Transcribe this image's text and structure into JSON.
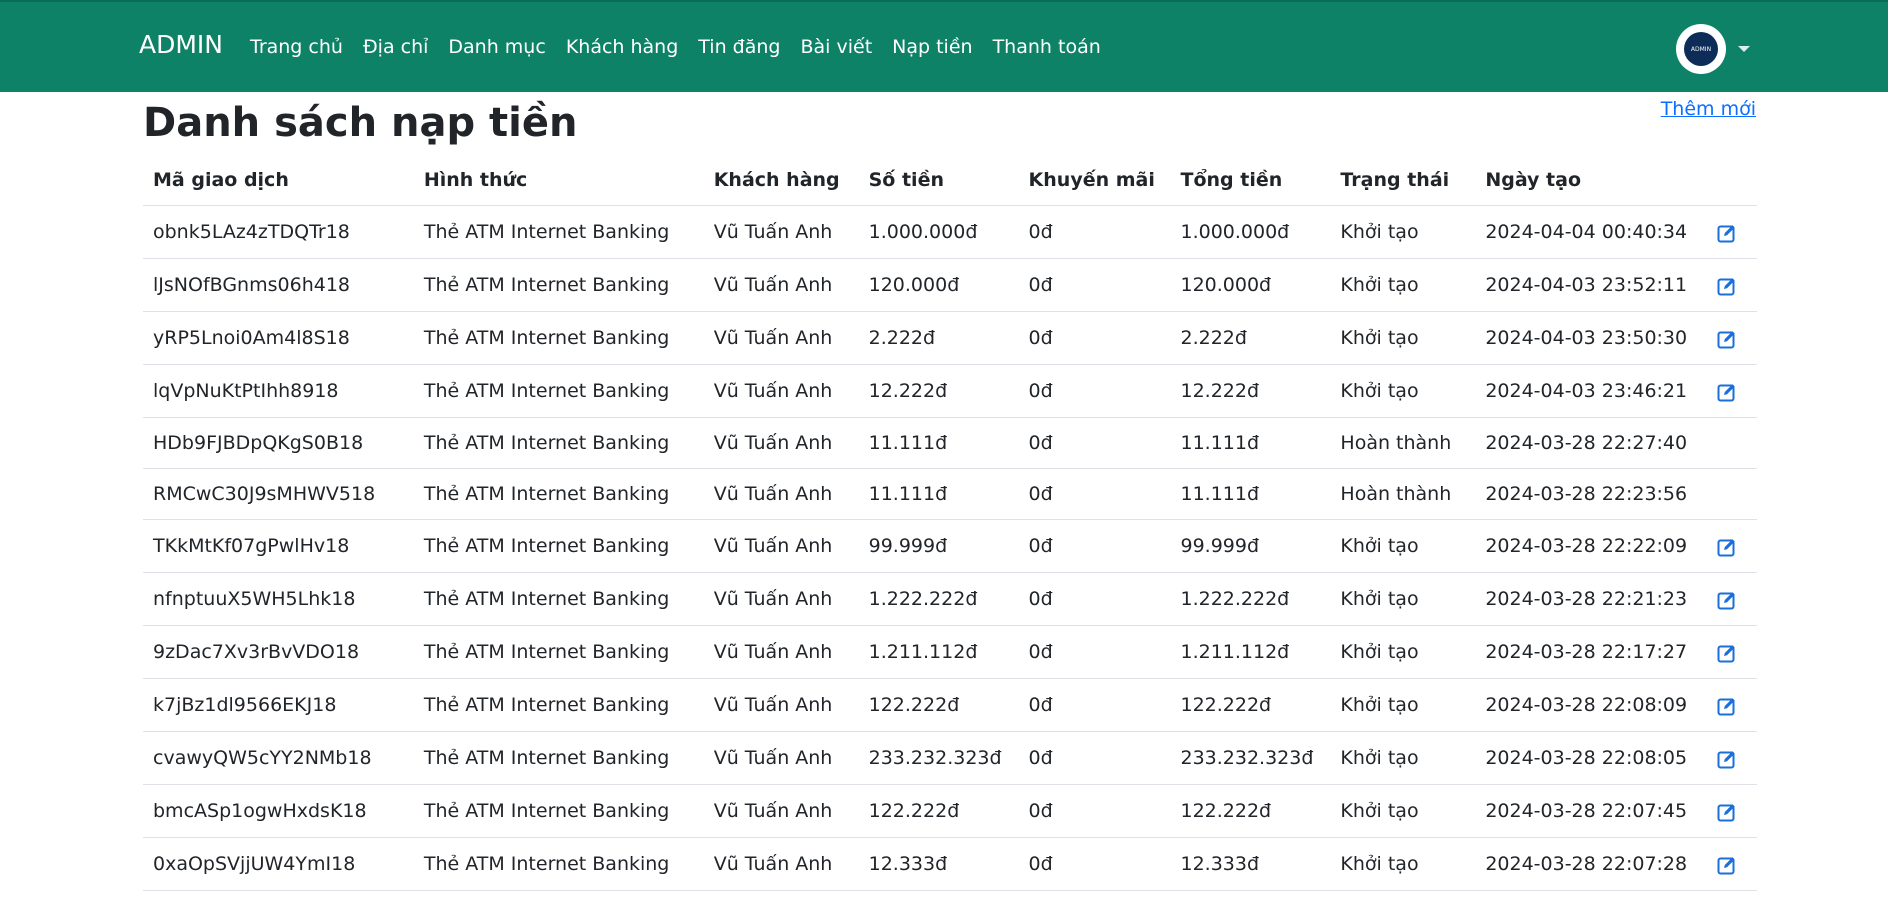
{
  "nav": {
    "brand": "ADMIN",
    "links": [
      "Trang chủ",
      "Địa chỉ",
      "Danh mục",
      "Khách hàng",
      "Tin đăng",
      "Bài viết",
      "Nạp tiền",
      "Thanh toán"
    ],
    "avatar_text": "ADMIN"
  },
  "page": {
    "title": "Danh sách nạp tiền",
    "add_label": "Thêm mới"
  },
  "table": {
    "headers": [
      "Mã giao dịch",
      "Hình thức",
      "Khách hàng",
      "Số tiền",
      "Khuyến mãi",
      "Tổng tiền",
      "Trạng thái",
      "Ngày tạo"
    ],
    "rows": [
      {
        "code": "obnk5LAz4zTDQTr18",
        "method": "Thẻ ATM Internet Banking",
        "customer": "Vũ Tuấn Anh",
        "amount": "1.000.000đ",
        "promo": "0đ",
        "total": "1.000.000đ",
        "status": "Khởi tạo",
        "date": "2024-04-04 00:40:34",
        "editable": true
      },
      {
        "code": "lJsNOfBGnms06h418",
        "method": "Thẻ ATM Internet Banking",
        "customer": "Vũ Tuấn Anh",
        "amount": "120.000đ",
        "promo": "0đ",
        "total": "120.000đ",
        "status": "Khởi tạo",
        "date": "2024-04-03 23:52:11",
        "editable": true
      },
      {
        "code": "yRP5Lnoi0Am4l8S18",
        "method": "Thẻ ATM Internet Banking",
        "customer": "Vũ Tuấn Anh",
        "amount": "2.222đ",
        "promo": "0đ",
        "total": "2.222đ",
        "status": "Khởi tạo",
        "date": "2024-04-03 23:50:30",
        "editable": true
      },
      {
        "code": "lqVpNuKtPtIhh8918",
        "method": "Thẻ ATM Internet Banking",
        "customer": "Vũ Tuấn Anh",
        "amount": "12.222đ",
        "promo": "0đ",
        "total": "12.222đ",
        "status": "Khởi tạo",
        "date": "2024-04-03 23:46:21",
        "editable": true
      },
      {
        "code": "HDb9FJBDpQKgS0B18",
        "method": "Thẻ ATM Internet Banking",
        "customer": "Vũ Tuấn Anh",
        "amount": "11.111đ",
        "promo": "0đ",
        "total": "11.111đ",
        "status": "Hoàn thành",
        "date": "2024-03-28 22:27:40",
        "editable": false
      },
      {
        "code": "RMCwC30J9sMHWV518",
        "method": "Thẻ ATM Internet Banking",
        "customer": "Vũ Tuấn Anh",
        "amount": "11.111đ",
        "promo": "0đ",
        "total": "11.111đ",
        "status": "Hoàn thành",
        "date": "2024-03-28 22:23:56",
        "editable": false
      },
      {
        "code": "TKkMtKf07gPwlHv18",
        "method": "Thẻ ATM Internet Banking",
        "customer": "Vũ Tuấn Anh",
        "amount": "99.999đ",
        "promo": "0đ",
        "total": "99.999đ",
        "status": "Khởi tạo",
        "date": "2024-03-28 22:22:09",
        "editable": true
      },
      {
        "code": "nfnptuuX5WH5Lhk18",
        "method": "Thẻ ATM Internet Banking",
        "customer": "Vũ Tuấn Anh",
        "amount": "1.222.222đ",
        "promo": "0đ",
        "total": "1.222.222đ",
        "status": "Khởi tạo",
        "date": "2024-03-28 22:21:23",
        "editable": true
      },
      {
        "code": "9zDac7Xv3rBvVDO18",
        "method": "Thẻ ATM Internet Banking",
        "customer": "Vũ Tuấn Anh",
        "amount": "1.211.112đ",
        "promo": "0đ",
        "total": "1.211.112đ",
        "status": "Khởi tạo",
        "date": "2024-03-28 22:17:27",
        "editable": true
      },
      {
        "code": "k7jBz1dl9566EKJ18",
        "method": "Thẻ ATM Internet Banking",
        "customer": "Vũ Tuấn Anh",
        "amount": "122.222đ",
        "promo": "0đ",
        "total": "122.222đ",
        "status": "Khởi tạo",
        "date": "2024-03-28 22:08:09",
        "editable": true
      },
      {
        "code": "cvawyQW5cYY2NMb18",
        "method": "Thẻ ATM Internet Banking",
        "customer": "Vũ Tuấn Anh",
        "amount": "233.232.323đ",
        "promo": "0đ",
        "total": "233.232.323đ",
        "status": "Khởi tạo",
        "date": "2024-03-28 22:08:05",
        "editable": true
      },
      {
        "code": "bmcASp1ogwHxdsK18",
        "method": "Thẻ ATM Internet Banking",
        "customer": "Vũ Tuấn Anh",
        "amount": "122.222đ",
        "promo": "0đ",
        "total": "122.222đ",
        "status": "Khởi tạo",
        "date": "2024-03-28 22:07:45",
        "editable": true
      },
      {
        "code": "0xaOpSVjjUW4YmI18",
        "method": "Thẻ ATM Internet Banking",
        "customer": "Vũ Tuấn Anh",
        "amount": "12.333đ",
        "promo": "0đ",
        "total": "12.333đ",
        "status": "Khởi tạo",
        "date": "2024-03-28 22:07:28",
        "editable": true
      }
    ]
  },
  "colors": {
    "navbar": "#0e8267",
    "total_red": "#dc3545",
    "status_done": "#198754",
    "status_init": "#8a8f94",
    "link_blue": "#0d6efd",
    "edit_icon": "#1a6fd8"
  }
}
